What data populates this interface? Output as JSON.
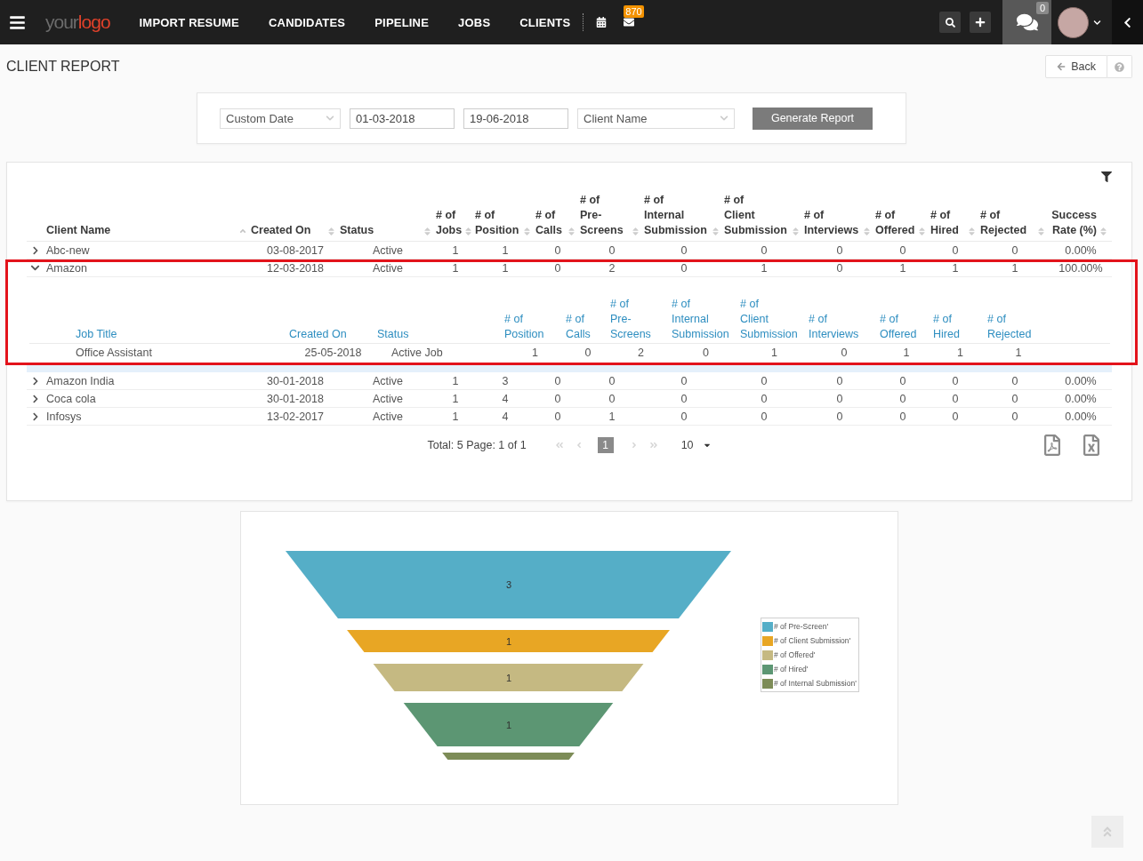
{
  "nav": {
    "logo": {
      "part_1": "your",
      "part_2": "logo"
    },
    "menu": [
      {
        "label": "IMPORT RESUME"
      },
      {
        "label": "CANDIDATES"
      },
      {
        "label": "PIPELINE"
      },
      {
        "label": "JOBS"
      },
      {
        "label": "CLIENTS"
      }
    ],
    "mail_badge": "870",
    "chat_badge": "0"
  },
  "page": {
    "title": "CLIENT REPORT",
    "back_button": "Back"
  },
  "filters": {
    "date_range": "Custom Date",
    "start_date": "01-03-2018",
    "end_date": "19-06-2018",
    "client": "Client Name",
    "generate_button": "Generate Report"
  },
  "table": {
    "columns": [
      {
        "label": "Client Name",
        "sorted": true
      },
      {
        "label": "Created On",
        "sorted": false
      },
      {
        "label": "Status",
        "sorted": false
      },
      {
        "label": "# of\nJobs",
        "sorted": false
      },
      {
        "label": "# of\nPosition",
        "sorted": false
      },
      {
        "label": "# of\nCalls",
        "sorted": false
      },
      {
        "label": "# of\nPre-\nScreens",
        "sorted": false
      },
      {
        "label": "# of\nInternal\nSubmission",
        "sorted": false
      },
      {
        "label": "# of\nClient\nSubmission",
        "sorted": false
      },
      {
        "label": "# of\nInterviews",
        "sorted": false
      },
      {
        "label": "# of\nOffered",
        "sorted": false
      },
      {
        "label": "# of\nHired",
        "sorted": false
      },
      {
        "label": "# of\nRejected",
        "sorted": false
      },
      {
        "label": "Success\nRate (%)",
        "sorted": false
      }
    ],
    "rows": [
      {
        "cells": [
          "Abc-new",
          "03-08-2017",
          "Active",
          "1",
          "1",
          "0",
          "0",
          "0",
          "0",
          "0",
          "0",
          "0",
          "0",
          "0.00%"
        ],
        "expanded": false,
        "highlighted": false
      },
      {
        "cells": [
          "Amazon",
          "12-03-2018",
          "Active",
          "1",
          "1",
          "0",
          "2",
          "0",
          "1",
          "0",
          "1",
          "1",
          "1",
          "100.00%"
        ],
        "expanded": true,
        "highlighted": true,
        "details": {
          "columns": [
            "Job Title",
            "Created On",
            "Status",
            "# of\nPosition",
            "# of\nCalls",
            "# of\nPre-\nScreens",
            "# of\nInternal\nSubmission",
            "# of\nClient\nSubmission",
            "# of\nInterviews",
            "# of\nOffered",
            "# of\nHired",
            "# of\nRejected"
          ],
          "rows": [
            {
              "cells": [
                "Office Assistant",
                "25-05-2018",
                "Active Job",
                "1",
                "0",
                "2",
                "0",
                "1",
                "0",
                "1",
                "1",
                "1"
              ]
            }
          ]
        }
      },
      {
        "cells": [
          "Amazon India",
          "30-01-2018",
          "Active",
          "1",
          "3",
          "0",
          "0",
          "0",
          "0",
          "0",
          "0",
          "0",
          "0",
          "0.00%"
        ],
        "expanded": false,
        "highlighted": false
      },
      {
        "cells": [
          "Coca cola",
          "30-01-2018",
          "Active",
          "1",
          "4",
          "0",
          "0",
          "0",
          "0",
          "0",
          "0",
          "0",
          "0",
          "0.00%"
        ],
        "expanded": false,
        "highlighted": false
      },
      {
        "cells": [
          "Infosys",
          "13-02-2017",
          "Active",
          "1",
          "4",
          "0",
          "1",
          "0",
          "0",
          "0",
          "0",
          "0",
          "0",
          "0.00%"
        ],
        "expanded": false,
        "highlighted": false
      }
    ]
  },
  "pagination": {
    "summary": "Total: 5 Page: 1 of 1",
    "nav_buttons": [
      {
        "kind": "first",
        "disabled": true
      },
      {
        "kind": "prev",
        "disabled": true
      },
      {
        "kind": "next",
        "disabled": true
      },
      {
        "kind": "last",
        "disabled": true
      }
    ],
    "pages": [
      {
        "label": "1",
        "selected": true
      }
    ],
    "page_size": "10"
  },
  "funnel": {
    "segments": [
      {
        "name": "# of Pre-Screen'",
        "value_label": "3",
        "color": "#55aec7"
      },
      {
        "name": "# of Client Submission'",
        "value_label": "1",
        "color": "#e8a624"
      },
      {
        "name": "# of Offered'",
        "value_label": "1",
        "color": "#c5b982"
      },
      {
        "name": "# of Hired'",
        "value_label": "1",
        "color": "#5c9673"
      },
      {
        "name": "# of Internal Submission'",
        "color": "#7d8c57"
      }
    ]
  }
}
